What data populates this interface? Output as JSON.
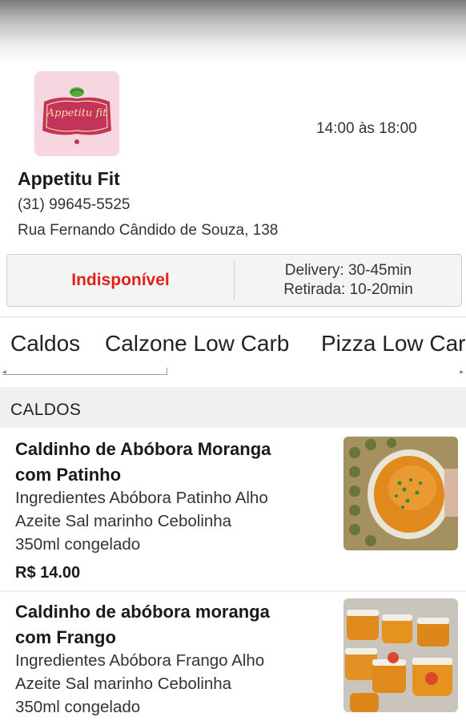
{
  "store": {
    "logo_text": "Appetitu fit",
    "hours": "14:00 às 18:00",
    "name": "Appetitu Fit",
    "phone": "(31) 99645-5525",
    "address": "Rua Fernando Cândido de Souza, 138"
  },
  "status": {
    "label": "Indisponível",
    "delivery": "Delivery: 30-45min",
    "pickup": "Retirada: 10-20min"
  },
  "tabs": [
    "Caldos",
    "Calzone Low Carb",
    "Pizza Low Carb"
  ],
  "section": {
    "title": "CALDOS"
  },
  "products": [
    {
      "name_line1": "Caldinho de Abóbora Moranga",
      "name_line2": "com Patinho",
      "desc_line1": "Ingredientes Abóbora Patinho Alho",
      "desc_line2": "Azeite Sal marinho Cebolinha",
      "desc_line3": "350ml congelado",
      "price": "R$ 14.00"
    },
    {
      "name_line1": "Caldinho de abóbora moranga",
      "name_line2": "com Frango",
      "desc_line1": "Ingredientes Abóbora Frango Alho",
      "desc_line2": "Azeite Sal marinho Cebolinha",
      "desc_line3": "350ml congelado"
    }
  ],
  "colors": {
    "unavailable": "#e0221e",
    "logo_bg": "#f6d7df",
    "logo_badge": "#c2345a",
    "soup_orange": "#e08a1e"
  },
  "icons": [
    "leaf-icon",
    "scroll-left-arrow-icon",
    "scroll-right-arrow-icon"
  ]
}
